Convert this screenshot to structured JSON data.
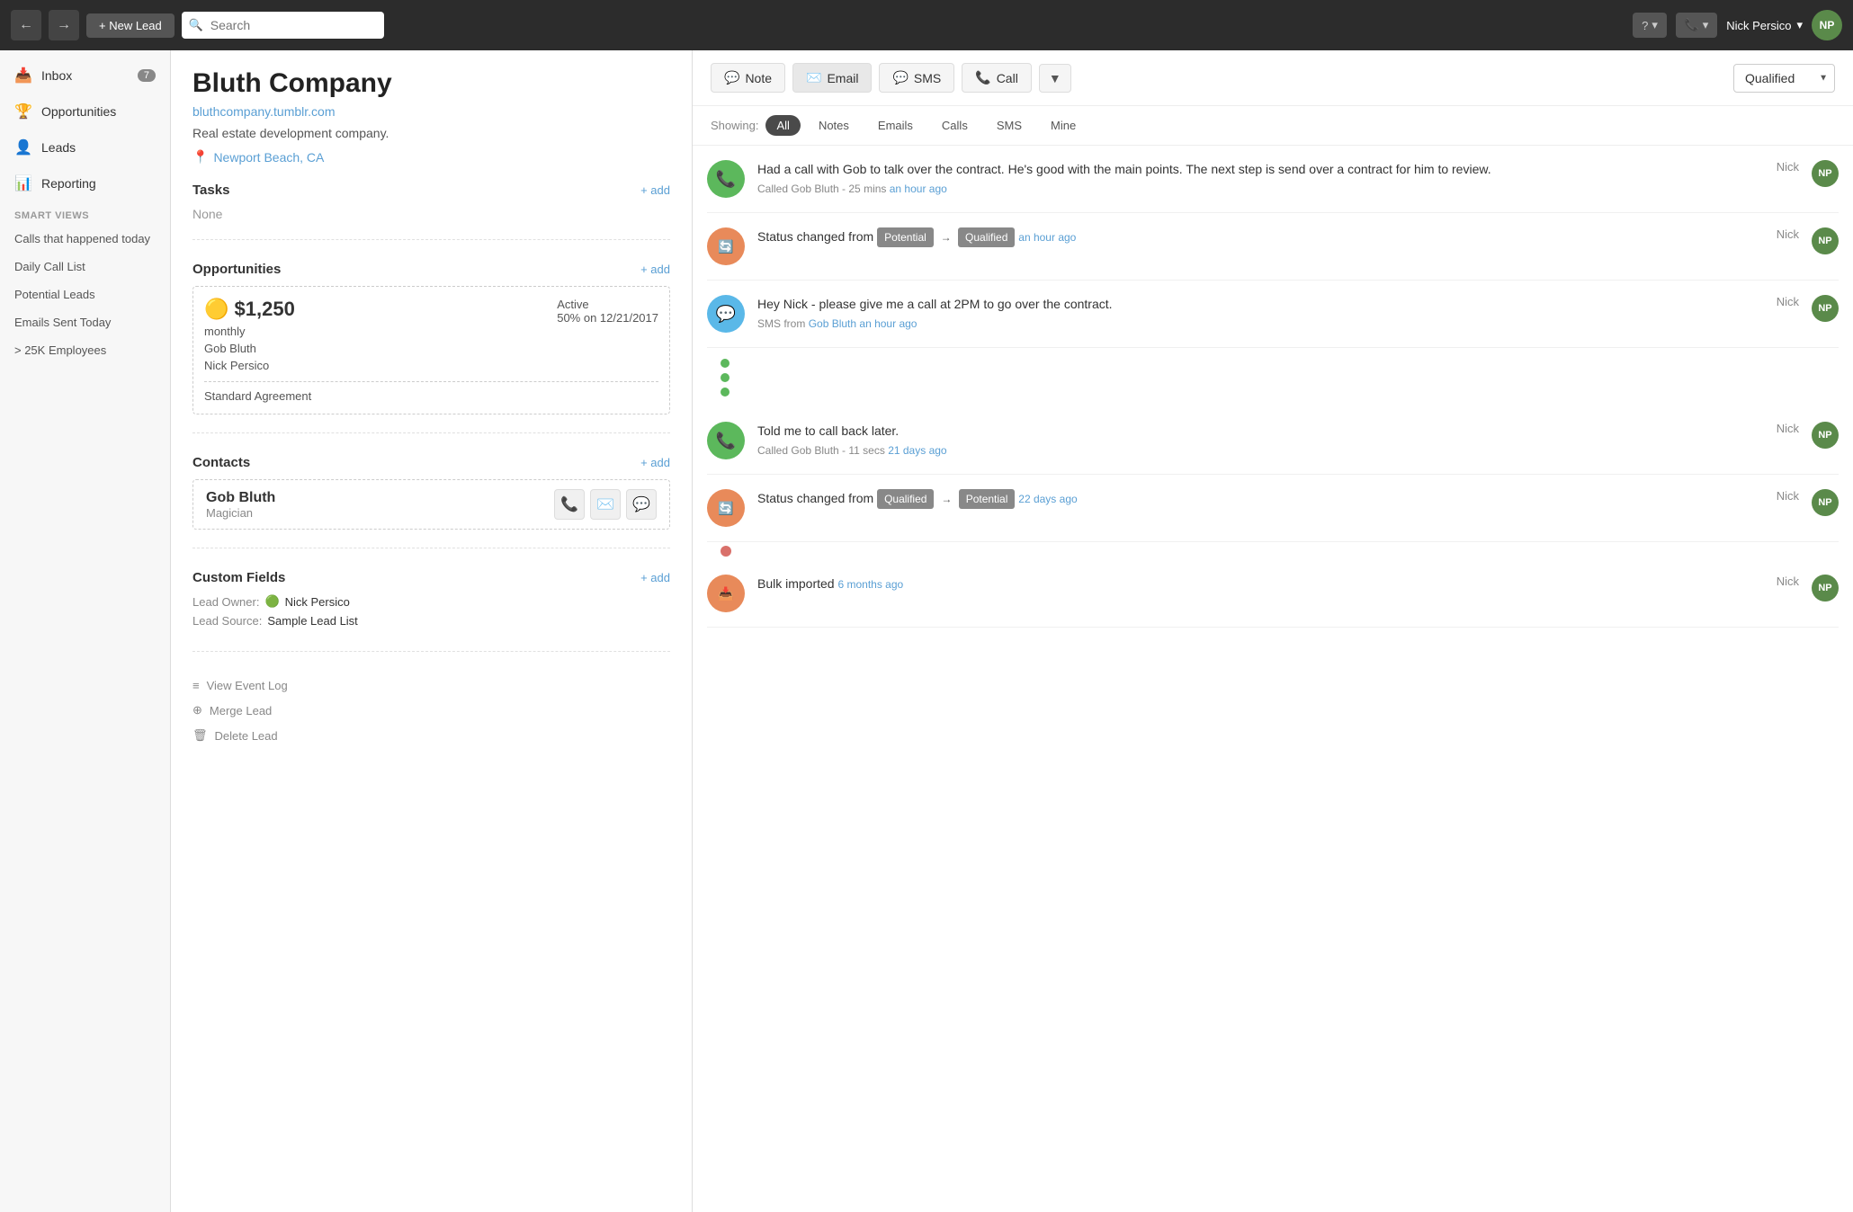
{
  "topnav": {
    "new_lead_label": "+ New Lead",
    "search_placeholder": "Search",
    "help_label": "?",
    "phone_label": "📞",
    "user_name": "Nick Persico",
    "avatar_initials": "NP"
  },
  "sidebar": {
    "items": [
      {
        "label": "Inbox",
        "icon": "📥",
        "badge": "7"
      },
      {
        "label": "Opportunities",
        "icon": "🏆"
      },
      {
        "label": "Leads",
        "icon": "👤"
      },
      {
        "label": "Reporting",
        "icon": "📊"
      }
    ],
    "smart_views_label": "SMART VIEWS",
    "smart_views": [
      {
        "label": "Calls that happened today"
      },
      {
        "label": "Daily Call List"
      },
      {
        "label": "Potential Leads"
      },
      {
        "label": "Emails Sent Today"
      },
      {
        "label": "> 25K Employees"
      }
    ]
  },
  "lead": {
    "company": "Bluth Company",
    "website": "bluthcompany.tumblr.com",
    "description": "Real estate development company.",
    "location": "Newport Beach, CA",
    "tasks_title": "Tasks",
    "tasks_none": "None",
    "opportunities_title": "Opportunities",
    "opp_amount": "$1,250",
    "opp_freq": "monthly",
    "opp_status": "Active",
    "opp_date": "50% on 12/21/2017",
    "opp_person1": "Gob Bluth",
    "opp_person2": "Nick Persico",
    "opp_agreement": "Standard Agreement",
    "contacts_title": "Contacts",
    "contact_name": "Gob Bluth",
    "contact_role": "Magician",
    "custom_fields_title": "Custom Fields",
    "field_owner_label": "Lead Owner:",
    "field_owner_value": "Nick Persico",
    "field_source_label": "Lead Source:",
    "field_source_value": "Sample Lead List",
    "view_event_log": "View Event Log",
    "merge_lead": "Merge Lead",
    "delete_lead": "Delete Lead"
  },
  "activity": {
    "actions": {
      "note_label": "Note",
      "email_label": "Email",
      "sms_label": "SMS",
      "call_label": "Call"
    },
    "status_label": "Qualified",
    "filter_label": "Showing:",
    "filters": [
      {
        "label": "All",
        "active": true
      },
      {
        "label": "Notes",
        "active": false
      },
      {
        "label": "Emails",
        "active": false
      },
      {
        "label": "Calls",
        "active": false
      },
      {
        "label": "SMS",
        "active": false
      },
      {
        "label": "Mine",
        "active": false
      }
    ],
    "items": [
      {
        "type": "call",
        "text": "Had a call with Gob to talk over the contract. He's good with the main points. The next step is send over a contract for him to review.",
        "meta": "Called Gob Bluth - 25 mins",
        "time": "an hour ago",
        "user": "Nick"
      },
      {
        "type": "status",
        "text_prefix": "Status changed from",
        "from_badge": "Potential",
        "to_badge": "Qualified",
        "time": "an hour ago",
        "user": "Nick"
      },
      {
        "type": "sms",
        "text": "Hey Nick - please give me a call at 2PM to go over the contract.",
        "meta_prefix": "SMS from",
        "meta_person": "Gob Bluth",
        "time": "an hour ago",
        "user": "Nick"
      },
      {
        "type": "dots"
      },
      {
        "type": "call",
        "text": "Told me to call back later.",
        "meta": "Called Gob Bluth - 11 secs",
        "time": "21 days ago",
        "user": "Nick"
      },
      {
        "type": "status",
        "text_prefix": "Status changed from",
        "from_badge": "Qualified",
        "to_badge": "Potential",
        "time": "22 days ago",
        "user": "Nick"
      },
      {
        "type": "dot_single"
      },
      {
        "type": "import",
        "text_prefix": "Bulk imported",
        "time": "6 months ago",
        "user": "Nick"
      }
    ]
  }
}
